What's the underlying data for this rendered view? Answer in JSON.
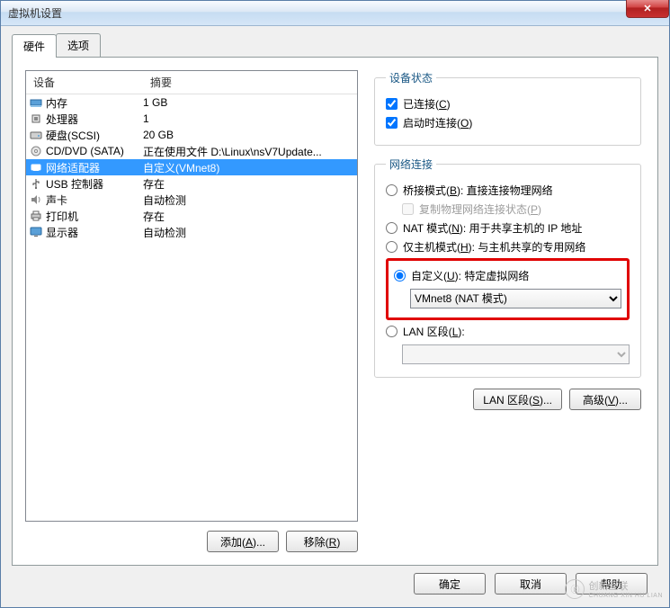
{
  "window": {
    "title": "虚拟机设置"
  },
  "tabs": {
    "hardware": "硬件",
    "options": "选项"
  },
  "list": {
    "header_device": "设备",
    "header_summary": "摘要",
    "rows": [
      {
        "icon": "memory",
        "device": "内存",
        "summary": "1 GB"
      },
      {
        "icon": "cpu",
        "device": "处理器",
        "summary": "1"
      },
      {
        "icon": "disk",
        "device": "硬盘(SCSI)",
        "summary": "20 GB"
      },
      {
        "icon": "cd",
        "device": "CD/DVD (SATA)",
        "summary": "正在使用文件 D:\\Linux\\nsV7Update..."
      },
      {
        "icon": "net",
        "device": "网络适配器",
        "summary": "自定义(VMnet8)"
      },
      {
        "icon": "usb",
        "device": "USB 控制器",
        "summary": "存在"
      },
      {
        "icon": "sound",
        "device": "声卡",
        "summary": "自动检测"
      },
      {
        "icon": "printer",
        "device": "打印机",
        "summary": "存在"
      },
      {
        "icon": "display",
        "device": "显示器",
        "summary": "自动检测"
      }
    ]
  },
  "leftButtons": {
    "add": "添加(A)...",
    "remove": "移除(R)"
  },
  "status": {
    "legend": "设备状态",
    "connected": "已连接(C)",
    "connect_on_start": "启动时连接(O)"
  },
  "network": {
    "legend": "网络连接",
    "bridged": "桥接模式(B): 直接连接物理网络",
    "replicate": "复制物理网络连接状态(P)",
    "nat": "NAT 模式(N): 用于共享主机的 IP 地址",
    "hostonly": "仅主机模式(H): 与主机共享的专用网络",
    "custom": "自定义(U): 特定虚拟网络",
    "custom_value": "VMnet8 (NAT 模式)",
    "lan": "LAN 区段(L):",
    "lan_value": ""
  },
  "rightButtons": {
    "lan_segments": "LAN 区段(S)...",
    "advanced": "高级(V)..."
  },
  "dialogButtons": {
    "ok": "确定",
    "cancel": "取消",
    "help": "帮助"
  },
  "watermark": {
    "main": "创新互联",
    "sub": "CHUANG XIN HU LIAN"
  },
  "accents": {
    "selection": "#3399ff",
    "highlight_border": "#e00000"
  }
}
